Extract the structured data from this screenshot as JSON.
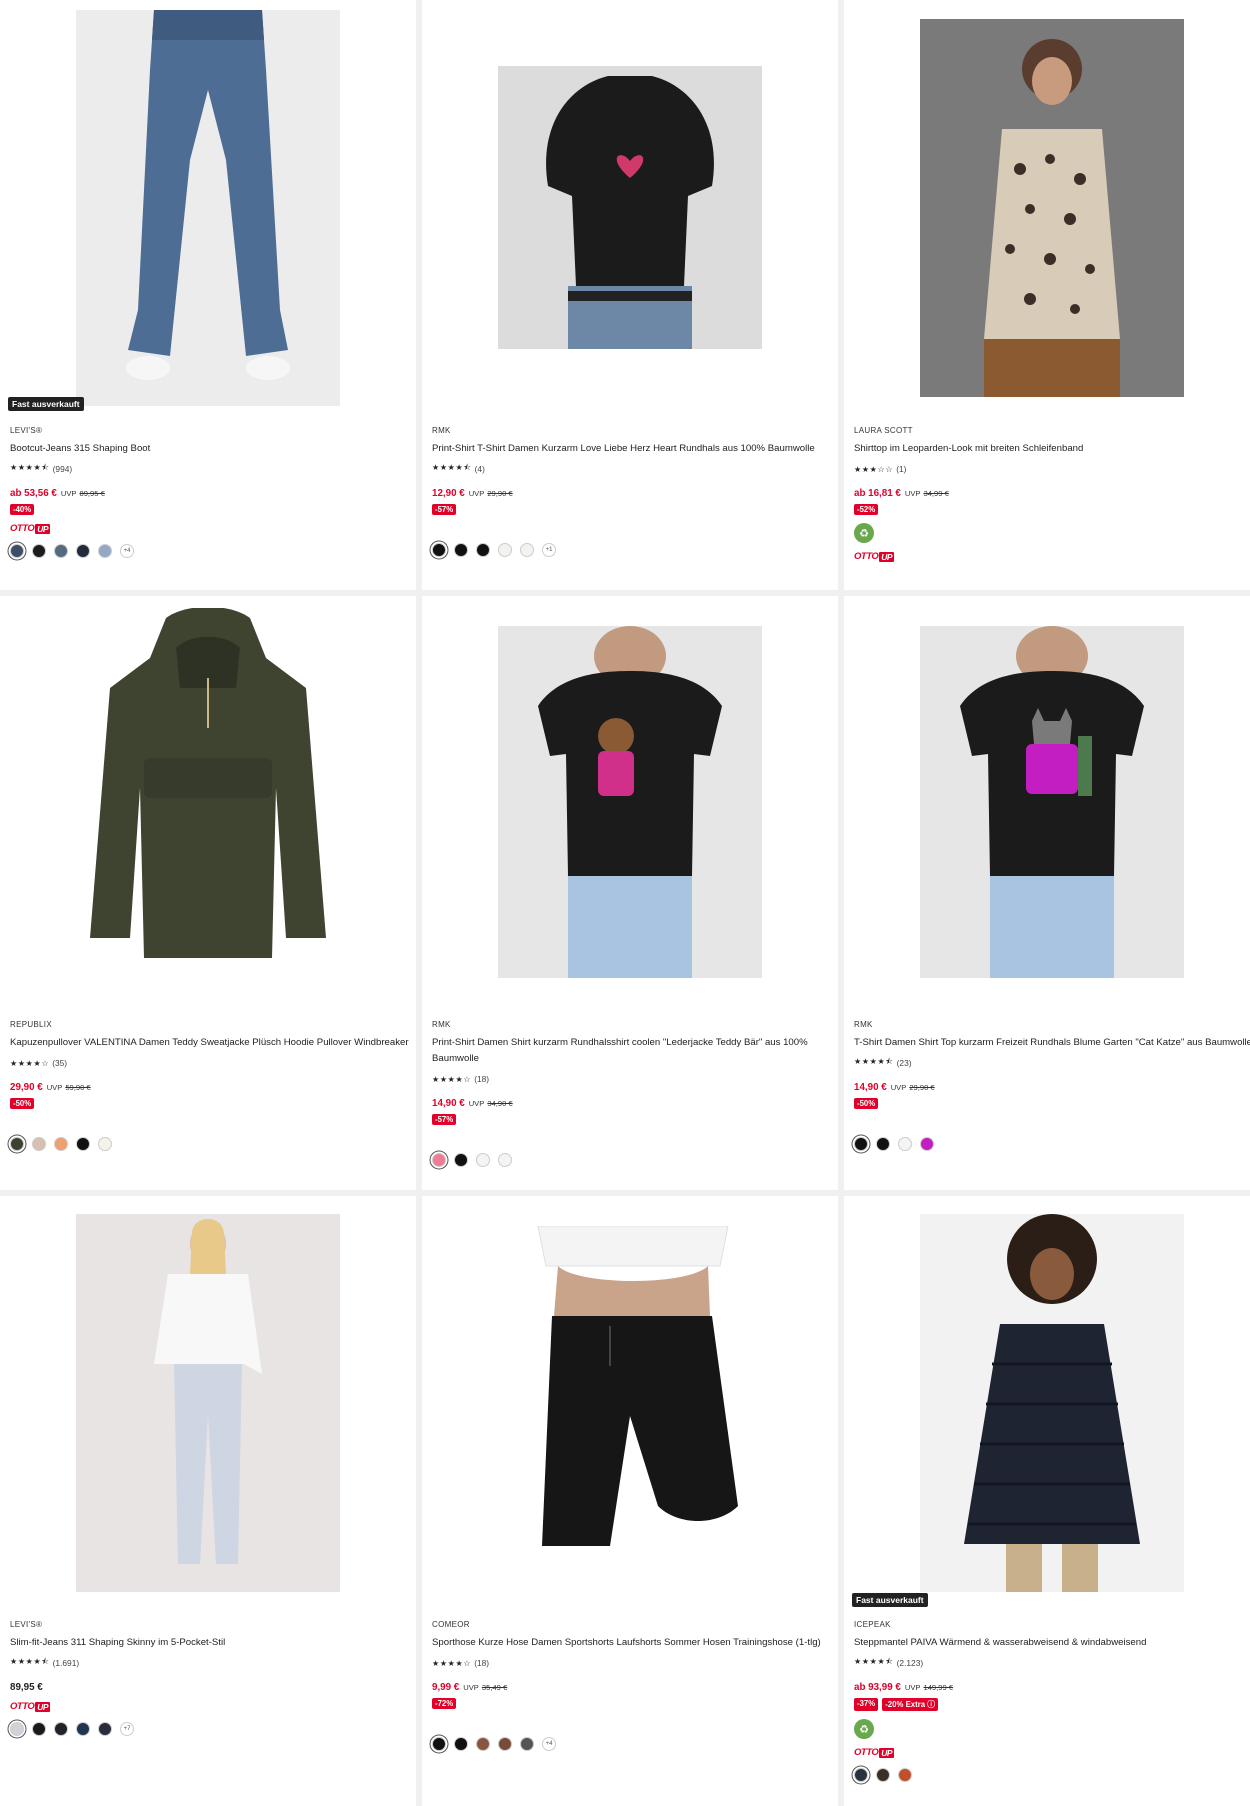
{
  "products": [
    {
      "badge": "Fast ausverkauft",
      "brand": "LEVI'S®",
      "title": "Bootcut-Jeans 315 Shaping Boot",
      "stars": "★★★★⯪",
      "rating_count": "(994)",
      "price": "ab 53,56 €",
      "uvp_label": "UVP",
      "uvp_old": "89,95 €",
      "discounts": [
        "-40%"
      ],
      "otto_up": true,
      "otto_label": "OTTO",
      "up_label": "UP",
      "eco": false,
      "swatches": [
        "#3d4f68",
        "#1c1c1c",
        "#536a80",
        "#232a3c",
        "#94a9c6"
      ],
      "more_colors": "+4",
      "image": "jeans-icon"
    },
    {
      "brand": "RMK",
      "title": "Print-Shirt T-Shirt Damen Kurzarm Love Liebe Herz Heart Rundhals aus 100% Baumwolle",
      "stars": "★★★★⯪",
      "rating_count": "(4)",
      "price": "12,90 €",
      "uvp_label": "UVP",
      "uvp_old": "29,90 €",
      "discounts": [
        "-57%"
      ],
      "otto_up": false,
      "eco": false,
      "swatches": [
        "#111111",
        "#111111",
        "#111111",
        "#f2f2ee",
        "#f2f2ee"
      ],
      "more_colors": "+1",
      "image": "tshirt-heart-icon"
    },
    {
      "brand": "LAURA SCOTT",
      "title": "Shirttop im Leoparden-Look mit breiten Schleifenband",
      "stars": "★★★☆☆",
      "rating_count": "(1)",
      "price": "ab 16,81 €",
      "uvp_label": "UVP",
      "uvp_old": "34,99 €",
      "discounts": [
        "-52%"
      ],
      "otto_up": true,
      "otto_label": "OTTO",
      "up_label": "UP",
      "eco": true,
      "eco_icon": "leaf-icon",
      "swatches": [],
      "more_colors": "",
      "image": "leopard-top-icon"
    },
    {
      "brand": "REPUBLIX",
      "title": "Kapuzenpullover VALENTINA Damen Teddy Sweatjacke Plüsch Hoodie Pullover Windbreaker",
      "stars": "★★★★☆",
      "rating_count": "(35)",
      "price": "29,90 €",
      "uvp_label": "UVP",
      "uvp_old": "59,90 €",
      "discounts": [
        "-50%"
      ],
      "otto_up": false,
      "eco": false,
      "swatches": [
        "#3c4232",
        "#d8bfae",
        "#f0a070",
        "#111111",
        "#f4f2ea"
      ],
      "more_colors": "",
      "image": "hoodie-icon"
    },
    {
      "brand": "RMK",
      "title": "Print-Shirt Damen Shirt kurzarm Rundhalsshirt coolen \"Lederjacke Teddy Bär\" aus 100% Baumwolle",
      "stars": "★★★★☆",
      "rating_count": "(18)",
      "price": "14,90 €",
      "uvp_label": "UVP",
      "uvp_old": "34,90 €",
      "discounts": [
        "-57%"
      ],
      "otto_up": false,
      "eco": false,
      "swatches": [
        "#f07b93",
        "#111111",
        "#f4f4f4",
        "#f4f4f4"
      ],
      "more_colors": "",
      "image": "tshirt-bear-icon"
    },
    {
      "brand": "RMK",
      "title": "T-Shirt Damen Shirt Top kurzarm Freizeit Rundhals Blume Garten \"Cat Katze\" aus Baumwolle",
      "stars": "★★★★⯪",
      "rating_count": "(23)",
      "price": "14,90 €",
      "uvp_label": "UVP",
      "uvp_old": "29,90 €",
      "discounts": [
        "-50%"
      ],
      "otto_up": false,
      "eco": false,
      "swatches": [
        "#111111",
        "#111111",
        "#f4f4f6",
        "#c21ec2"
      ],
      "more_colors": "",
      "image": "tshirt-cat-icon"
    },
    {
      "brand": "LEVI'S®",
      "title": "Slim-fit-Jeans 311 Shaping Skinny im 5-Pocket-Stil",
      "stars": "★★★★⯪",
      "rating_count": "(1.691)",
      "price": "89,95 €",
      "uvp_label": "",
      "uvp_old": "",
      "discounts": [],
      "otto_up": true,
      "otto_label": "OTTO",
      "up_label": "UP",
      "eco": false,
      "swatches": [
        "#cfd3d8",
        "#1a1a1a",
        "#202428",
        "#1f3550",
        "#2a2e3a"
      ],
      "more_colors": "+7",
      "image": "skinny-jeans-icon"
    },
    {
      "brand": "COMEOR",
      "title": "Sporthose Kurze Hose Damen Sportshorts Laufshorts Sommer Hosen Trainingshose (1-tlg)",
      "stars": "★★★★☆",
      "rating_count": "(18)",
      "price": "9,99 €",
      "uvp_label": "UVP",
      "uvp_old": "35,49 €",
      "discounts": [
        "-72%"
      ],
      "otto_up": false,
      "eco": false,
      "swatches": [
        "#111111",
        "#111111",
        "#8a5540",
        "#7a4a38",
        "#555555"
      ],
      "more_colors": "+4",
      "image": "shorts-icon"
    },
    {
      "badge": "Fast ausverkauft",
      "brand": "ICEPEAK",
      "title": "Steppmantel PAIVA Wärmend & wasserabweisend & windabweisend",
      "stars": "★★★★⯪",
      "rating_count": "(2.123)",
      "price": "ab 93,99 €",
      "uvp_label": "UVP",
      "uvp_old": "149,99 €",
      "discounts": [
        "-37%",
        "-20% Extra ⓘ"
      ],
      "otto_up": true,
      "otto_label": "OTTO",
      "up_label": "UP",
      "eco": true,
      "eco_icon": "leaf-icon",
      "swatches": [
        "#2a3140",
        "#3a2e28",
        "#c0502a"
      ],
      "more_colors": "",
      "image": "puffer-coat-icon"
    }
  ]
}
